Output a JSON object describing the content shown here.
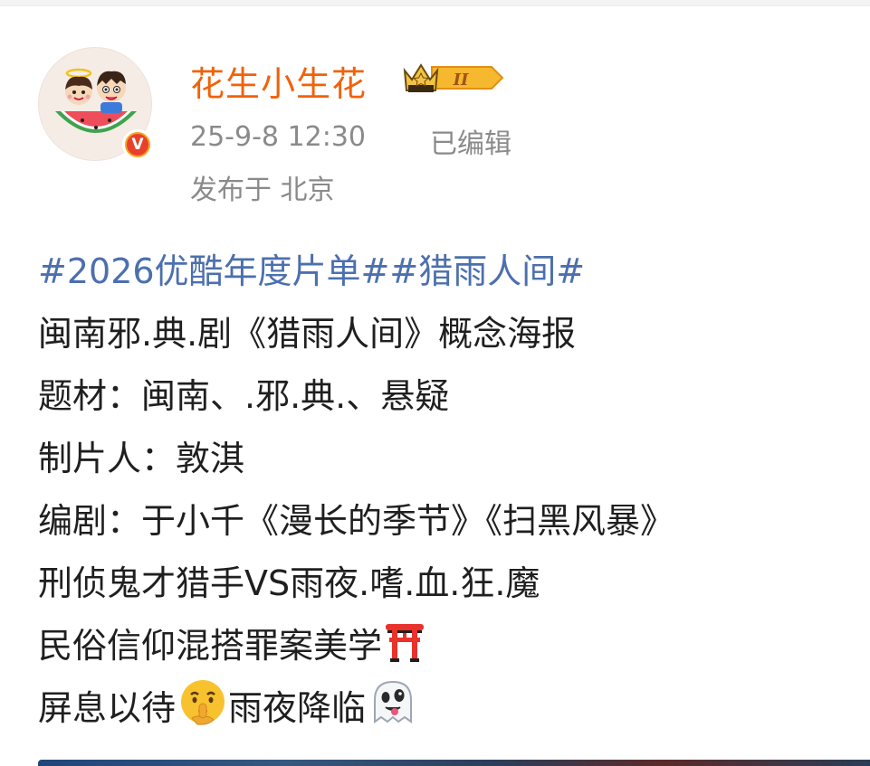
{
  "colors": {
    "username": "#f0620a",
    "hashtag": "#4c6fae",
    "meta": "#8a8a8a",
    "body_text": "#1f1f1f",
    "verified_badge": "#f5a623"
  },
  "post": {
    "author": {
      "name": "花生小生花",
      "avatar_icon": "cartoon-couple-watermelon-avatar",
      "verified_icon": "verified-v-badge",
      "verified_mark": "V",
      "level_badge_icon": "crown-level-badge",
      "level_label": "II"
    },
    "timestamp": "25-9-8 12:30",
    "edited_label": "已编辑",
    "location": "发布于 北京",
    "hashtags": [
      "#2026优酷年度片单#",
      "#猎雨人间#"
    ],
    "lines": [
      "闽南邪.典.剧《猎雨人间》概念海报",
      "题材：闽南、.邪.典.、悬疑",
      "制片人：敦淇",
      "编剧：于小千《漫长的季节》《扫黑风暴》",
      "刑侦鬼才猎手VS雨夜.嗜.血.狂.魔",
      "民俗信仰混搭罪案美学",
      "屏息以待",
      "雨夜降临"
    ],
    "emojis": {
      "torii": "torii-gate-emoji",
      "shush": "shushing-face-emoji",
      "ghost": "ghost-emoji"
    },
    "image_preview": "post-image-preview"
  }
}
